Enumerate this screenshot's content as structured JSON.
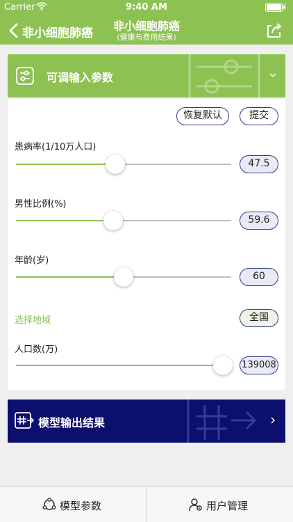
{
  "status_bar": {
    "carrier": "Carrier",
    "time": "9:40 AM"
  },
  "nav": {
    "back_label": "非小细胞肺癌",
    "title": "非小细胞肺癌",
    "subtitle": "(健康与费用结果)",
    "share_icon": "share-icon"
  },
  "input_section": {
    "title": "可调输入参数",
    "icon": "sliders-icon"
  },
  "actions": {
    "reset_label": "恢复默认",
    "submit_label": "提交"
  },
  "params": [
    {
      "label": "患病率(1/10万人口)",
      "value": "47.5",
      "slider_fraction": 0.46
    },
    {
      "label": "男性比例(%)",
      "value": "59.6",
      "slider_fraction": 0.45
    },
    {
      "label": "年龄(岁)",
      "value": "60",
      "slider_fraction": 0.5
    }
  ],
  "region": {
    "label": "选择地域",
    "value": "全国"
  },
  "population": {
    "label": "人口数(万)",
    "value": "139008",
    "slider_fraction": 0.96
  },
  "output_section": {
    "title": "模型输出结果",
    "icon": "grid-arrow-icon"
  },
  "tabs": [
    {
      "label": "模型参数",
      "icon": "network-icon"
    },
    {
      "label": "用户管理",
      "icon": "user-gear-icon"
    }
  ],
  "colors": {
    "brand_green": "#8dc152",
    "navy": "#0d0f6e",
    "pill_border": "#2e3a8c"
  }
}
